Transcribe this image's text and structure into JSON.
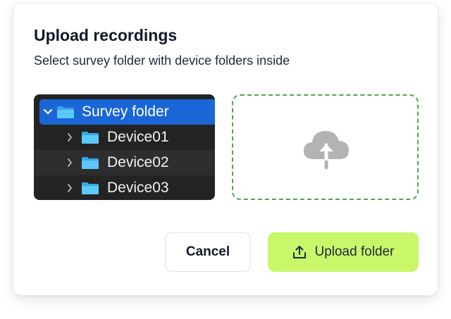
{
  "dialog": {
    "title": "Upload recordings",
    "subtitle": "Select survey folder with device folders inside"
  },
  "preview": {
    "selected_folder": {
      "label": "Survey folder",
      "icon": "folder-icon",
      "expanded": true
    },
    "children": [
      {
        "label": "Device01",
        "icon": "folder-icon"
      },
      {
        "label": "Device02",
        "icon": "folder-icon"
      },
      {
        "label": "Device03",
        "icon": "folder-icon"
      }
    ]
  },
  "dropzone": {
    "icon": "cloud-upload-icon",
    "border_color": "#4fa84a"
  },
  "actions": {
    "cancel_label": "Cancel",
    "upload_label": "Upload folder",
    "upload_icon": "upload-icon",
    "upload_color": "#c8f76a"
  },
  "colors": {
    "selection": "#1a66d6",
    "folder": "#4fc3f7"
  }
}
